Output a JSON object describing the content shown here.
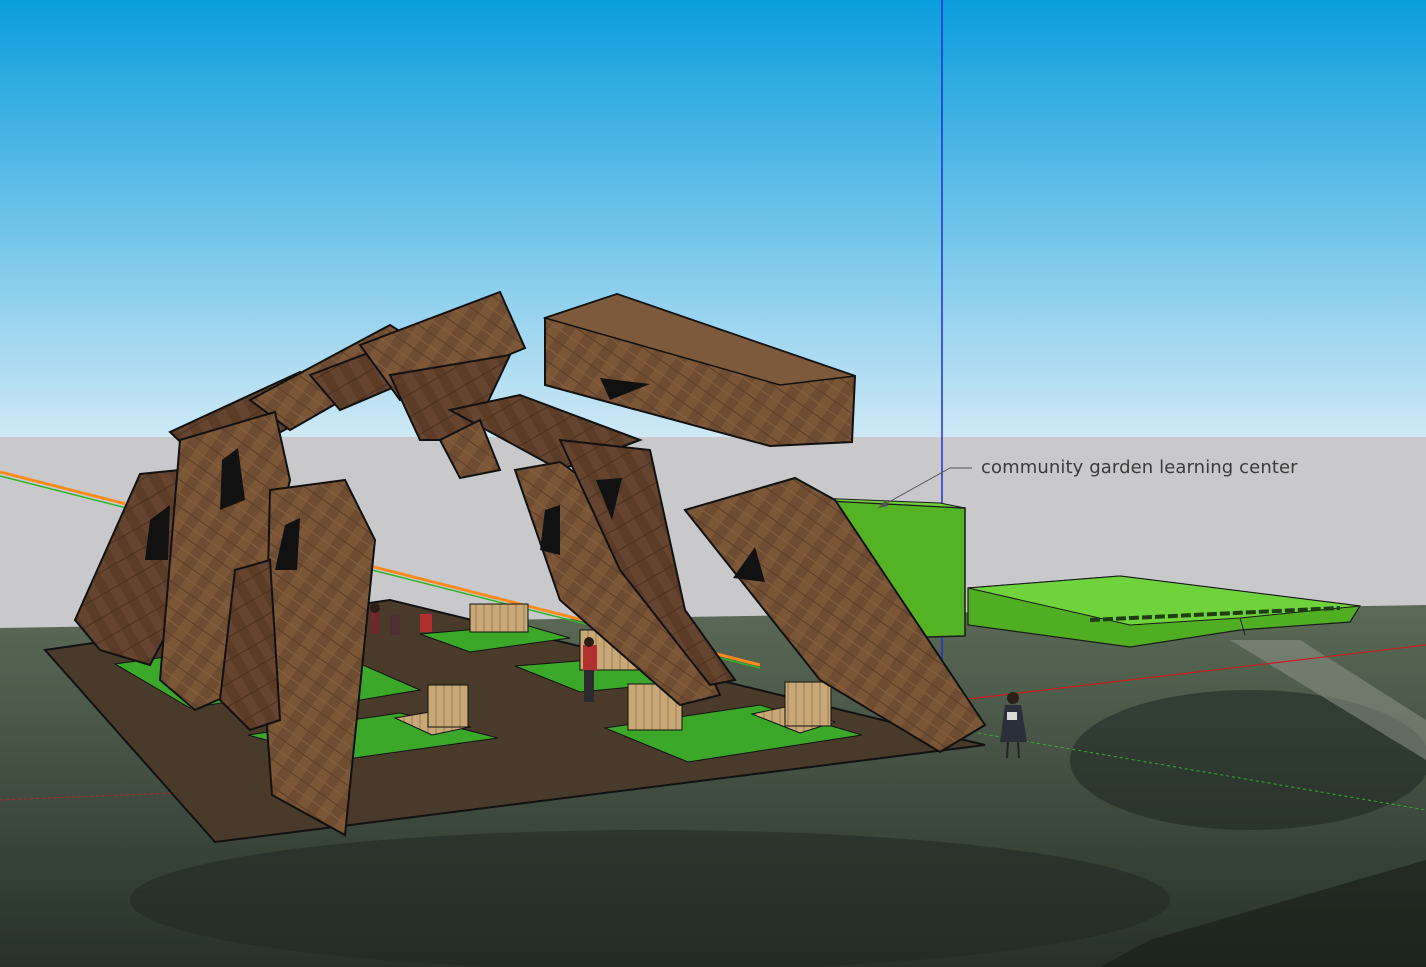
{
  "app": {
    "type": "3d-modeling-viewport"
  },
  "annotation": {
    "label": "community garden learning center"
  },
  "scene": {
    "sky_top_color": "#0a9ddc",
    "sky_bottom_color": "#cfe9f6",
    "horizon_color": "#c9c9cb",
    "ground_color": "#3f4d3c",
    "deck_color": "#4a3a2a",
    "wood_color": "#6b4a30",
    "green_block_color": "#4caa1c",
    "axis_blue": "#1f2fd6",
    "axis_red": "#c81e1e",
    "axis_green": "#2bb52b",
    "axis_orange": "#ff8a1a"
  }
}
